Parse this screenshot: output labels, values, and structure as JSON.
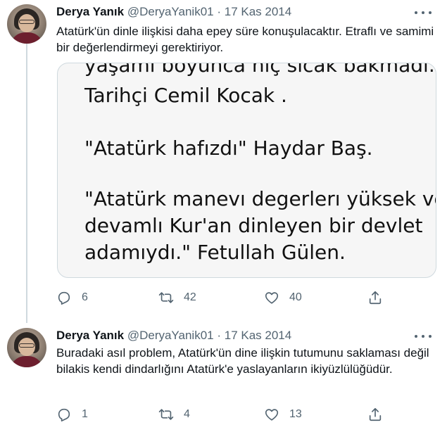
{
  "tweets": [
    {
      "author_name": "Derya Yanık",
      "handle": "@DeryaYanik01",
      "separator": "·",
      "date": "17 Kas 2014",
      "text": "Atatürk'ün dinle ilişkisi daha epey süre konuşulacaktır. Etraflı ve samimi bir değerlendirmeyi gerektiriyor.",
      "media_text": [
        "yaşamı boyunca hiç sıcak bakmadı.\"",
        "Tarihçi Cemil Kocak .",
        "\"Atatürk hafızdı\" Haydar Baş.",
        "\"Atatürk manevı degerlerı yüksek ve",
        "devamlı Kur'an dinleyen bir devlet",
        "adamıydı.\" Fetullah Gülen."
      ],
      "replies": "6",
      "retweets": "42",
      "likes": "40"
    },
    {
      "author_name": "Derya Yanık",
      "handle": "@DeryaYanik01",
      "separator": "·",
      "date": "17 Kas 2014",
      "text": "Buradaki asıl problem, Atatürk'ün dine ilişkin tutumunu saklaması değil bilakis kendi dindarlığını Atatürk'e yaslayanların ikiyüzlülüğüdür.",
      "replies": "1",
      "retweets": "4",
      "likes": "13"
    }
  ],
  "colors": {
    "text": "#0f1419",
    "secondary": "#536471",
    "border": "#cfd9de"
  },
  "icons": [
    "reply-icon",
    "retweet-icon",
    "like-icon",
    "share-icon",
    "more-icon"
  ]
}
